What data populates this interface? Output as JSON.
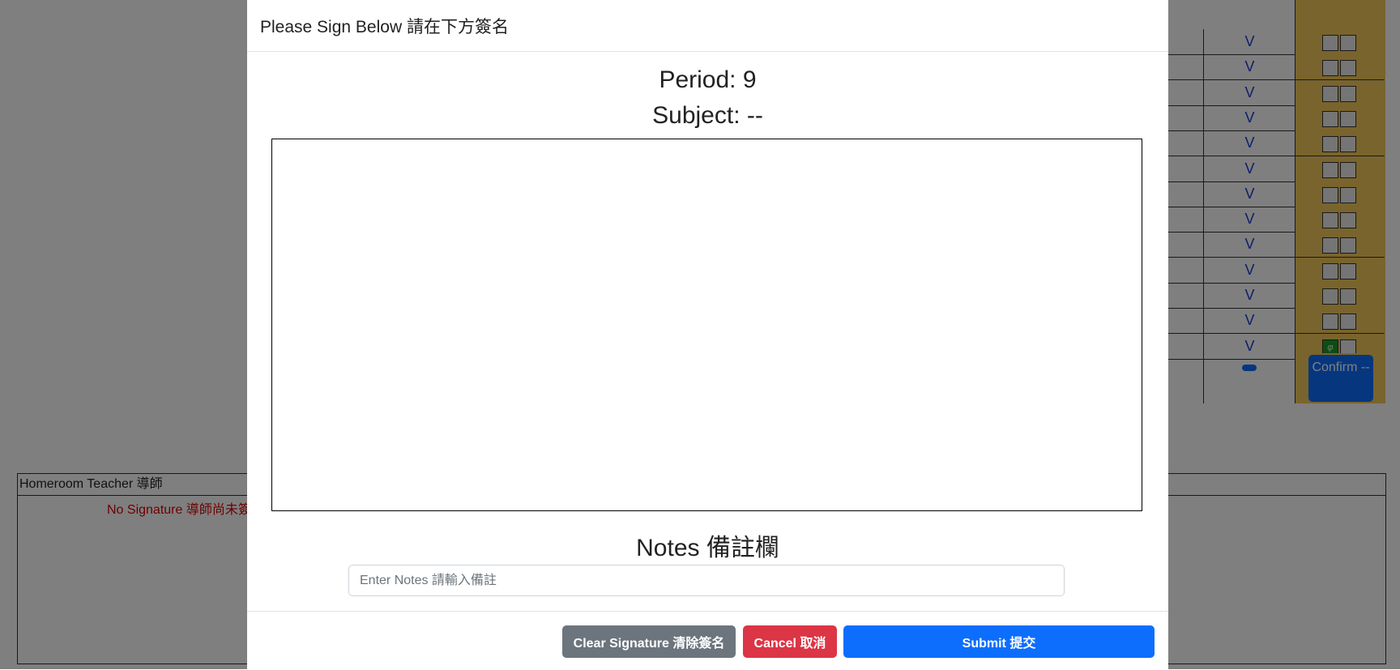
{
  "background": {
    "row_marks": [
      "V",
      "V",
      "V",
      "V",
      "V",
      "V",
      "V",
      "V",
      "V",
      "V",
      "V",
      "V",
      "V"
    ],
    "green_box_glyph": "φ",
    "confirm_label": "Confirm --",
    "homeroom": {
      "header": "Homeroom Teacher 導師",
      "status": "No Signature 導師尚未簽"
    }
  },
  "modal": {
    "title": "Please Sign Below 請在下方簽名",
    "period": "Period: 9",
    "subject": "Subject: --",
    "notes_title": "Notes 備註欄",
    "notes_placeholder": "Enter Notes 請輸入備註",
    "notes_value": "",
    "buttons": {
      "clear": "Clear Signature 清除簽名",
      "cancel": "Cancel 取消",
      "submit": "Submit 提交"
    }
  },
  "colors": {
    "overlay": "#808080",
    "checkbox_column": "#f2c95b",
    "primary": "#0d6efd",
    "secondary": "#6c757d",
    "danger": "#dc3545",
    "error_text": "#dd0000"
  }
}
